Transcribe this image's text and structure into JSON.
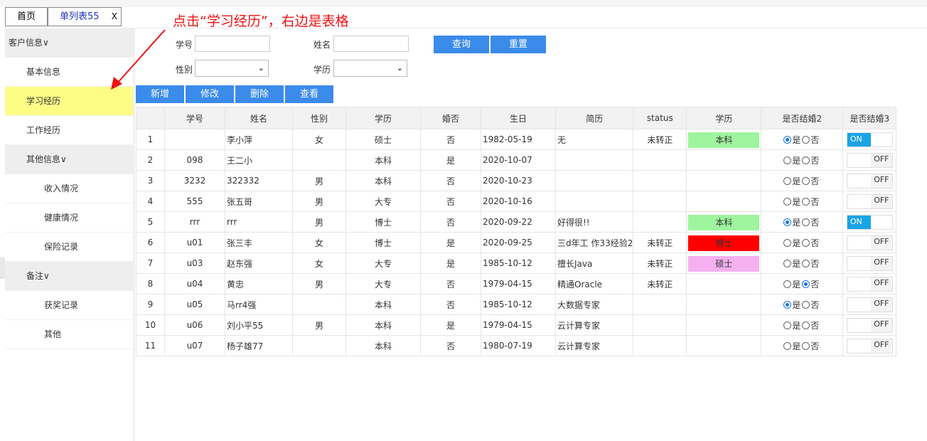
{
  "tabs": {
    "home": "首页",
    "list": "单列表55",
    "close": "X"
  },
  "annotation": "点击“学习经历”，右边是表格",
  "sidebar": {
    "items": [
      {
        "label": "客户信息∨",
        "level": 0,
        "group": true
      },
      {
        "label": "基本信息",
        "level": 1
      },
      {
        "label": "学习经历",
        "level": 1,
        "active": true
      },
      {
        "label": "工作经历",
        "level": 1
      },
      {
        "label": "其他信息∨",
        "level": 1,
        "group": true
      },
      {
        "label": "收入情况",
        "level": 2
      },
      {
        "label": "健康情况",
        "level": 2
      },
      {
        "label": "保险记录",
        "level": 2
      },
      {
        "label": "备注∨",
        "level": 1,
        "group": true
      },
      {
        "label": "获奖记录",
        "level": 2
      },
      {
        "label": "其他",
        "level": 2
      }
    ]
  },
  "search": {
    "student_no_label": "学号",
    "student_no_value": "",
    "name_label": "姓名",
    "name_value": "",
    "gender_label": "性别",
    "gender_value": "",
    "education_label": "学历",
    "education_value": "",
    "query_button": "查询",
    "reset_button": "重置"
  },
  "toolbar": {
    "add": "新增",
    "edit": "修改",
    "delete": "删除",
    "view": "查看"
  },
  "table": {
    "headers": [
      "",
      "学号",
      "姓名",
      "性别",
      "学历",
      "婚否",
      "生日",
      "简历",
      "status",
      "学历",
      "是否结婚2",
      "是否结婚3"
    ],
    "radio_yes": "是",
    "radio_no": "否",
    "toggle_on": "ON",
    "toggle_off": "OFF",
    "rows": [
      {
        "n": "1",
        "no": "",
        "name": "李小萍",
        "gender": "女",
        "edu": "硕士",
        "married": "否",
        "birthday": "1982-05-19",
        "resume": "无",
        "status": "未转正",
        "tag": "本科",
        "tag_color": "#9ef59e",
        "radio": "yes",
        "toggle": true
      },
      {
        "n": "2",
        "no": "098",
        "name": "王二小",
        "gender": "",
        "edu": "本科",
        "married": "是",
        "birthday": "2020-10-07",
        "resume": "",
        "status": "",
        "tag": "",
        "tag_color": "",
        "radio": "none",
        "toggle": false
      },
      {
        "n": "3",
        "no": "3232",
        "name": "322332",
        "gender": "男",
        "edu": "本科",
        "married": "否",
        "birthday": "2020-10-23",
        "resume": "",
        "status": "",
        "tag": "",
        "tag_color": "",
        "radio": "none",
        "toggle": false
      },
      {
        "n": "4",
        "no": "555",
        "name": "张五哥",
        "gender": "男",
        "edu": "大专",
        "married": "否",
        "birthday": "2020-10-16",
        "resume": "",
        "status": "",
        "tag": "",
        "tag_color": "",
        "radio": "none",
        "toggle": false
      },
      {
        "n": "5",
        "no": "rrr",
        "name": "rrr",
        "gender": "男",
        "edu": "博士",
        "married": "否",
        "birthday": "2020-09-22",
        "resume": "好得很!!",
        "status": "",
        "tag": "本科",
        "tag_color": "#9ef59e",
        "radio": "yes",
        "toggle": true
      },
      {
        "n": "6",
        "no": "u01",
        "name": "张三丰",
        "gender": "女",
        "edu": "博士",
        "married": "是",
        "birthday": "2020-09-25",
        "resume": "三d年工 作33经验2",
        "status": "未转正",
        "tag": "博士",
        "tag_color": "#ff0000",
        "radio": "none",
        "toggle": false
      },
      {
        "n": "7",
        "no": "u03",
        "name": "赵东强",
        "gender": "女",
        "edu": "大专",
        "married": "是",
        "birthday": "1985-10-12",
        "resume": "擅长Java",
        "status": "未转正",
        "tag": "硕士",
        "tag_color": "#f5b0f0",
        "radio": "none",
        "toggle": false
      },
      {
        "n": "8",
        "no": "u04",
        "name": "黄忠",
        "gender": "男",
        "edu": "大专",
        "married": "否",
        "birthday": "1979-04-15",
        "resume": "精通Oracle",
        "status": "未转正",
        "tag": "",
        "tag_color": "",
        "radio": "no",
        "toggle": false
      },
      {
        "n": "9",
        "no": "u05",
        "name": "马rr4强",
        "gender": "",
        "edu": "本科",
        "married": "否",
        "birthday": "1985-10-12",
        "resume": "大数据专家",
        "status": "",
        "tag": "",
        "tag_color": "",
        "radio": "yes",
        "toggle": false
      },
      {
        "n": "10",
        "no": "u06",
        "name": "刘小平55",
        "gender": "男",
        "edu": "本科",
        "married": "是",
        "birthday": "1979-04-15",
        "resume": "云计算专家",
        "status": "",
        "tag": "",
        "tag_color": "",
        "radio": "none",
        "toggle": false
      },
      {
        "n": "11",
        "no": "u07",
        "name": "杨子雄77",
        "gender": "",
        "edu": "本科",
        "married": "否",
        "birthday": "1980-07-19",
        "resume": "云计算专家",
        "status": "",
        "tag": "",
        "tag_color": "",
        "radio": "none",
        "toggle": false
      }
    ]
  }
}
